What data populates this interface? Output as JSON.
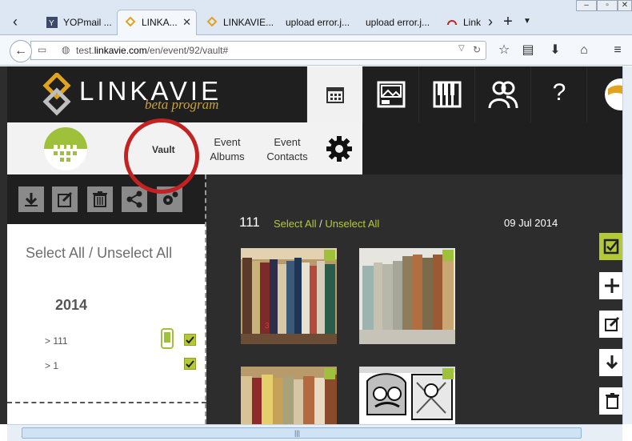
{
  "browser": {
    "tabs": [
      {
        "label": "YOPmail ..."
      },
      {
        "label": "LINKA...",
        "active": true
      },
      {
        "label": "LINKAVIE..."
      },
      {
        "label": "upload error.j..."
      },
      {
        "label": "upload error.j..."
      },
      {
        "label": "Link"
      }
    ],
    "url_prefix": "test.",
    "url_domain": "linkavie.com",
    "url_path": "/en/event/92/vault#"
  },
  "header": {
    "logo_text": "LINKAVIE",
    "logo_subtitle": "beta program",
    "help_label": "?"
  },
  "subnav": {
    "vault_label": "Vault",
    "albums_line1": "Event",
    "albums_line2": "Albums",
    "contacts_line1": "Event",
    "contacts_line2": "Contacts"
  },
  "sidebar": {
    "select_all": "Select All",
    "separator": "/",
    "unselect_all": "Unselect All",
    "year": "2014",
    "albums": [
      {
        "label": "> 111",
        "has_phone": true
      },
      {
        "label": "> 1",
        "has_phone": false
      }
    ]
  },
  "content": {
    "album_title": "111",
    "select_all": "Select All",
    "separator": "/",
    "unselect_all": "Unselect All",
    "date": "09 Jul 2014"
  },
  "colors": {
    "accent_green": "#b5c937",
    "dark_bg": "#2d2d2d",
    "header_bg": "#1f1f1f",
    "annotation_red": "#c42222"
  },
  "icons": [
    "calendar-icon",
    "photo-album-icon",
    "piano-icon",
    "contacts-icon",
    "help-icon",
    "download-icon",
    "edit-icon",
    "trash-icon",
    "share-icon",
    "settings-icon",
    "plus-icon",
    "phone-icon"
  ]
}
